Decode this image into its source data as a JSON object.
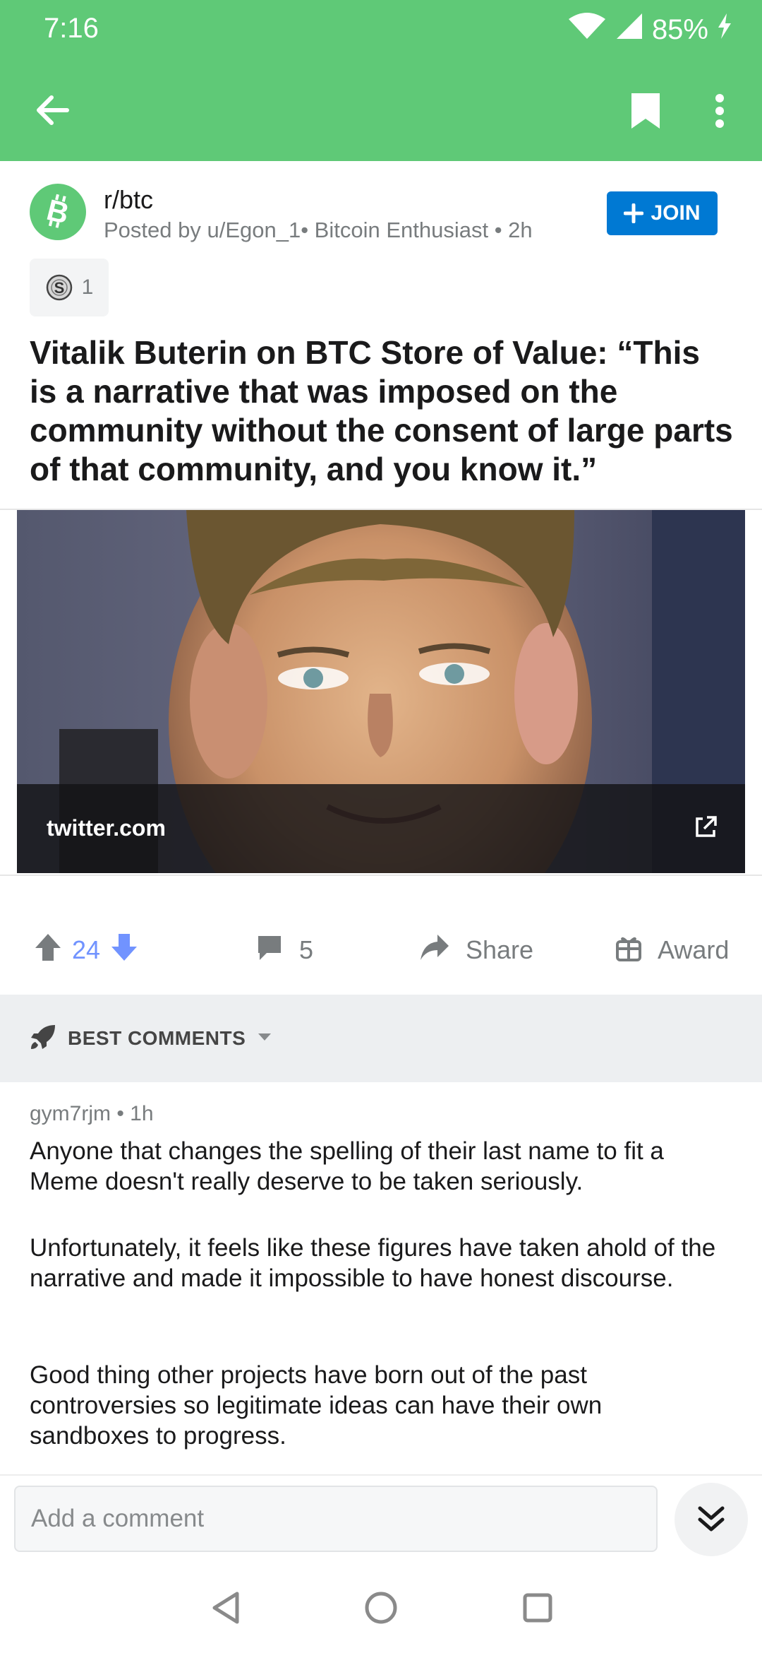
{
  "status_bar": {
    "time": "7:16",
    "battery": "85%"
  },
  "app_bar": {
    "back_icon": "arrow-left-icon",
    "bookmark_icon": "bookmark-icon",
    "more_icon": "more-vertical-icon"
  },
  "post": {
    "subreddit": "r/btc",
    "meta": "Posted by u/Egon_1• Bitcoin Enthusiast • 2h",
    "join_label": "JOIN",
    "award_count": "1",
    "title": "Vitalik Buterin on BTC Store of Value: “This is a narrative that was imposed on the community without the consent of large parts of that community, and you know it.”",
    "link_domain": "twitter.com",
    "votes": "24",
    "comments": "5",
    "share_label": "Share",
    "award_label": "Award"
  },
  "comments_section": {
    "sort_label": "BEST COMMENTS",
    "comments": [
      {
        "meta": "gym7rjm • 1h",
        "paragraphs": [
          "Anyone that changes the spelling of their last name to fit a Meme doesn't really deserve to be taken seriously.",
          "Unfortunately, it feels like these figures have taken ahold of the narrative and made it impossible to have honest discourse.",
          "Good thing other projects have born out of the past controversies so legitimate ideas can have their own sandboxes to progress."
        ]
      }
    ]
  },
  "composer": {
    "placeholder": "Add a comment"
  },
  "colors": {
    "app_bar": "#5fc977",
    "join_button": "#0079d3",
    "upvote_count": "#7193ff",
    "downvote": "#7193ff"
  }
}
